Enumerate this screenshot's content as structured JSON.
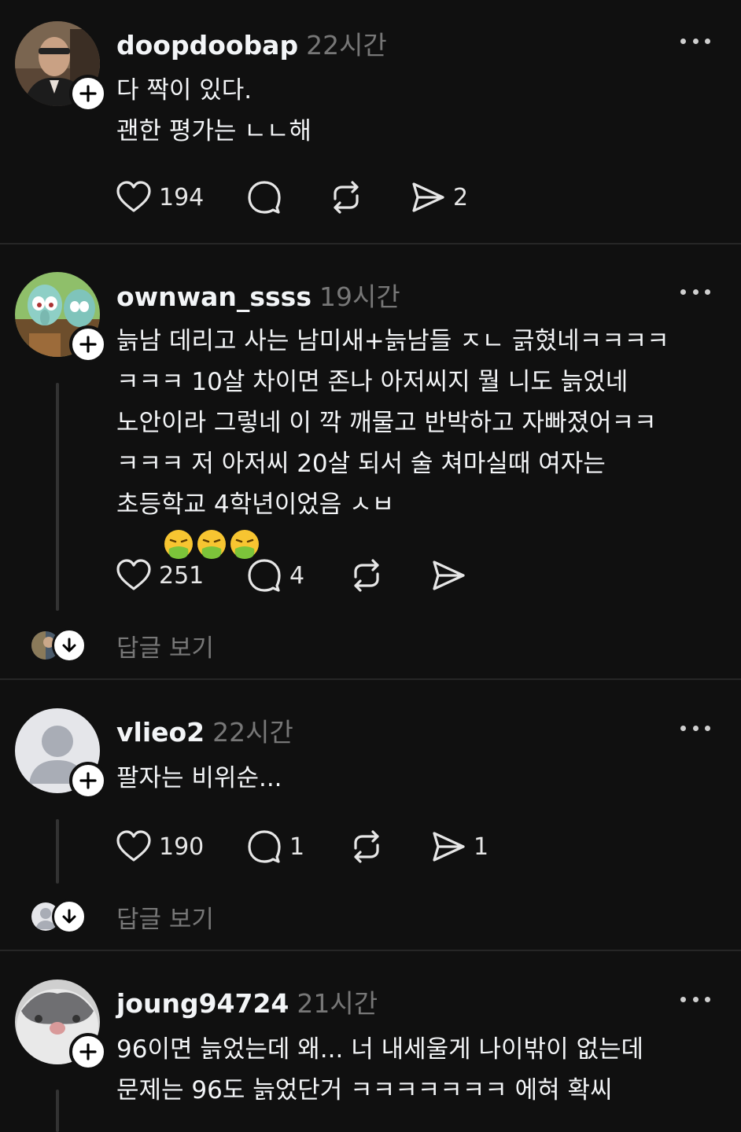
{
  "posts": [
    {
      "username": "doopdoobap",
      "time": "22시간",
      "text": "다 짝이 있다.\n괜한 평가는 ㄴㄴ해",
      "likes": "194",
      "comments": "",
      "shares": "2",
      "view_replies": ""
    },
    {
      "username": "ownwan_ssss",
      "time": "19시간",
      "text": "늙남 데리고 사는 남미새+늙남들 ㅈㄴ 긁혔네ㅋㅋㅋㅋ\nㅋㅋㅋ 10살 차이면 존나 아저씨지 뭘 니도 늙었네\n노안이라 그렇네 이 깍 깨물고 반박하고 자빠졌어ㅋㅋ\nㅋㅋㅋ 저 아저씨 20살 되서 술 쳐마실때 여자는\n초등학교 4학년이었음 ㅅㅂ ",
      "emoji": "🤮🤮🤮",
      "likes": "251",
      "comments": "4",
      "shares": "",
      "view_replies": "답글 보기"
    },
    {
      "username": "vlieo2",
      "time": "22시간",
      "text": "팔자는 비위순...",
      "likes": "190",
      "comments": "1",
      "shares": "1",
      "view_replies": "답글 보기"
    },
    {
      "username": "joung94724",
      "time": "21시간",
      "text": "96이면 늙었는데 왜... 너 내세울게 나이밖이 없는데\n문제는 96도 늙었단거 ㅋㅋㅋㅋㅋㅋㅋ 에혀 확씨"
    }
  ],
  "icons": {
    "like": "heart-icon",
    "comment": "comment-bubble-icon",
    "repost": "repost-icon",
    "share": "send-icon",
    "more": "more-dots-icon",
    "follow": "plus-icon",
    "expand": "arrow-down-icon"
  },
  "colors": {
    "background": "#101010",
    "text": "#f3f5f7",
    "muted": "#777777",
    "divider": "#262626"
  }
}
